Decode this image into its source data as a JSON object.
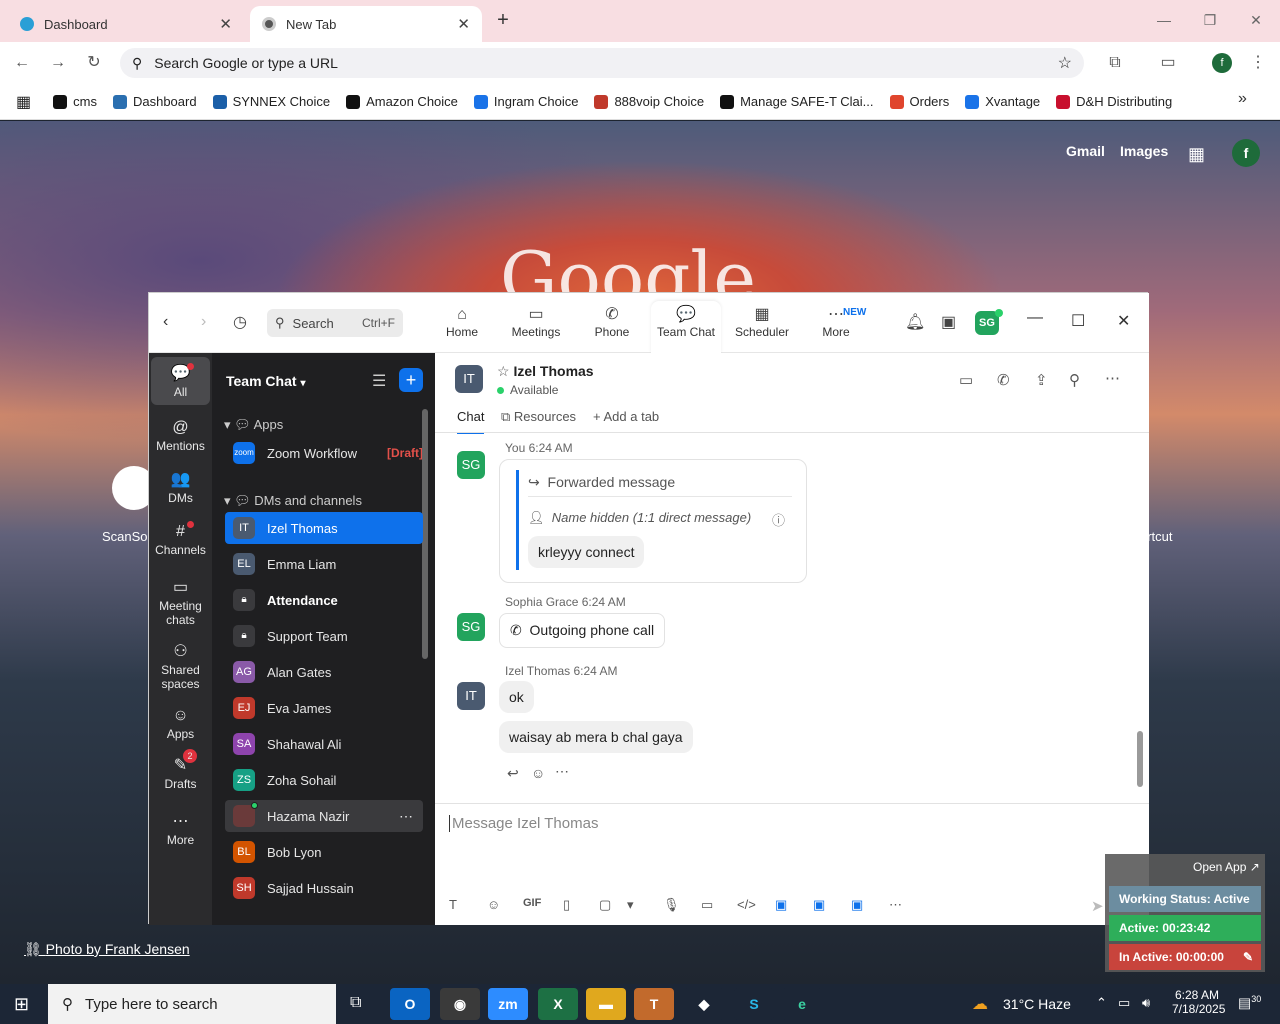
{
  "browser": {
    "tabs": [
      {
        "label": "Dashboard"
      },
      {
        "label": "New Tab"
      }
    ],
    "omnibox_placeholder": "Search Google or type a URL",
    "profile_initial": "f",
    "bookmarks": [
      {
        "label": "cms",
        "color": "#111111"
      },
      {
        "label": "Dashboard",
        "color": "#2a6fb0"
      },
      {
        "label": "SYNNEX Choice",
        "color": "#1b5fa8"
      },
      {
        "label": "Amazon Choice",
        "color": "#111111"
      },
      {
        "label": "Ingram Choice",
        "color": "#1a73e8"
      },
      {
        "label": "888voip Choice",
        "color": "#c0392b"
      },
      {
        "label": "Manage SAFE-T Clai...",
        "color": "#111111"
      },
      {
        "label": "Orders",
        "color": "#e0452d"
      },
      {
        "label": "Xvantage",
        "color": "#1a73e8"
      },
      {
        "label": "D&H Distributing",
        "color": "#c8102e"
      }
    ]
  },
  "newtab": {
    "gmail": "Gmail",
    "images": "Images",
    "avatar": "f",
    "logo": "Google",
    "shortcut_left": "ScanSou",
    "shortcut_right": "ortcut",
    "photo_credit": "Photo by Frank Jensen"
  },
  "zoom": {
    "search_placeholder": "Search",
    "search_shortcut": "Ctrl+F",
    "nav": [
      {
        "label": "Home",
        "icon": "⌂"
      },
      {
        "label": "Meetings",
        "icon": "▭"
      },
      {
        "label": "Phone",
        "icon": "✆"
      },
      {
        "label": "Team Chat",
        "icon": "💬"
      },
      {
        "label": "Scheduler",
        "icon": "▦"
      },
      {
        "label": "More",
        "icon": "⋯"
      }
    ],
    "new_badge": "NEW",
    "user_initials": "SG",
    "rail": [
      {
        "label": "All",
        "icon": "💬"
      },
      {
        "label": "Mentions",
        "icon": "@"
      },
      {
        "label": "DMs",
        "icon": "👥"
      },
      {
        "label": "Channels",
        "icon": "#"
      },
      {
        "label": "Meeting chats",
        "icon": "▭"
      },
      {
        "label": "Shared spaces",
        "icon": "⚇"
      },
      {
        "label": "Apps",
        "icon": "☺"
      },
      {
        "label": "Drafts",
        "icon": "✎",
        "badge": "2"
      },
      {
        "label": "More",
        "icon": "⋯"
      }
    ],
    "list": {
      "title": "Team Chat",
      "apps_header": "Apps",
      "app": {
        "label": "Zoom Workflow",
        "draft": "[Draft]",
        "logo": "zoom"
      },
      "dms_header": "DMs and channels",
      "items": [
        {
          "initials": "IT",
          "name": "Izel Thomas",
          "color": "#4a5a70"
        },
        {
          "initials": "EL",
          "name": "Emma Liam",
          "color": "#4a5a70"
        },
        {
          "initials": "",
          "name": "Attendance",
          "color": "#3a3a3d"
        },
        {
          "initials": "",
          "name": "Support Team",
          "color": "#3a3a3d"
        },
        {
          "initials": "AG",
          "name": "Alan Gates",
          "color": "#8a5aa8"
        },
        {
          "initials": "EJ",
          "name": "Eva James",
          "color": "#c0392b"
        },
        {
          "initials": "SA",
          "name": "Shahawal Ali",
          "color": "#8e44ad"
        },
        {
          "initials": "ZS",
          "name": "Zoha Sohail",
          "color": "#16a085"
        },
        {
          "initials": "",
          "name": "Hazama Nazir",
          "color": "#6a3a3a"
        },
        {
          "initials": "BL",
          "name": "Bob Lyon",
          "color": "#d35400"
        },
        {
          "initials": "SH",
          "name": "Sajjad Hussain",
          "color": "#c0392b"
        }
      ]
    },
    "chat": {
      "initials": "IT",
      "name": "Izel Thomas",
      "status": "Available",
      "tabs": {
        "chat": "Chat",
        "resources": "Resources",
        "add": "Add a tab"
      },
      "messages": [
        {
          "sender": "You",
          "time": "6:24 AM",
          "initials": "SG",
          "forward_label": "Forwarded message",
          "hidden_name": "Name hidden (1:1 direct message)",
          "text": "krleyyy connect"
        },
        {
          "sender": "Sophia Grace",
          "time": "6:24 AM",
          "initials": "SG",
          "text": "Outgoing phone call"
        },
        {
          "sender": "Izel Thomas",
          "time": "6:24 AM",
          "initials": "IT",
          "texts": [
            "ok",
            "waisay ab mera b chal gaya"
          ]
        }
      ],
      "composer_placeholder": "Message Izel Thomas",
      "toolbar_gif": "GIF"
    }
  },
  "widget": {
    "open": "Open App ↗",
    "working": "Working Status: Active",
    "active": "Active: 00:23:42",
    "inactive": "In Active: 00:00:00"
  },
  "taskbar": {
    "search": "Type here to search",
    "weather": "31°C  Haze",
    "time": "6:28 AM",
    "date": "7/18/2025",
    "notif": "30"
  }
}
